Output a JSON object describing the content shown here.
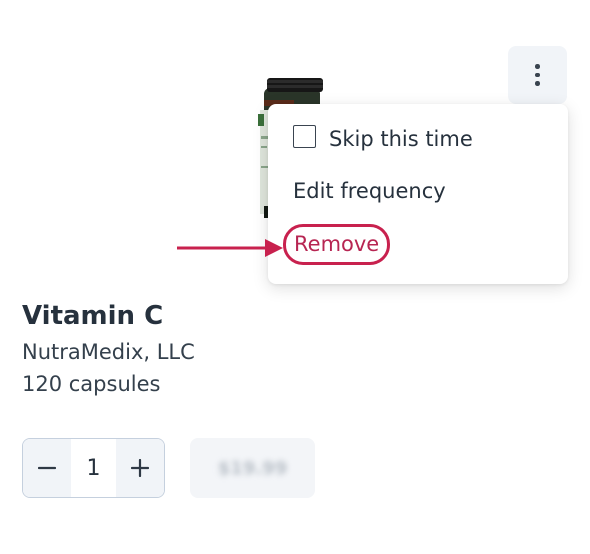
{
  "product": {
    "name": "Vitamin C",
    "brand": "NutraMedix, LLC",
    "size": "120 capsules",
    "price": "$19.99",
    "image_icon": "supplement-bottle-icon"
  },
  "menu": {
    "items": [
      {
        "label": "Skip this time",
        "checked": false
      },
      {
        "label": "Edit frequency"
      },
      {
        "label": "Remove"
      }
    ],
    "trigger_icon": "more-vertical-icon"
  },
  "quantity": {
    "value": "1",
    "decrement_icon": "minus-icon",
    "increment_icon": "plus-icon"
  },
  "annotation": {
    "type": "arrow",
    "target": "Remove",
    "color": "#c8214e"
  },
  "colors": {
    "text": "#26313d",
    "remove": "#b72552",
    "highlight": "#c8214e",
    "button_bg": "#f1f4f8"
  }
}
